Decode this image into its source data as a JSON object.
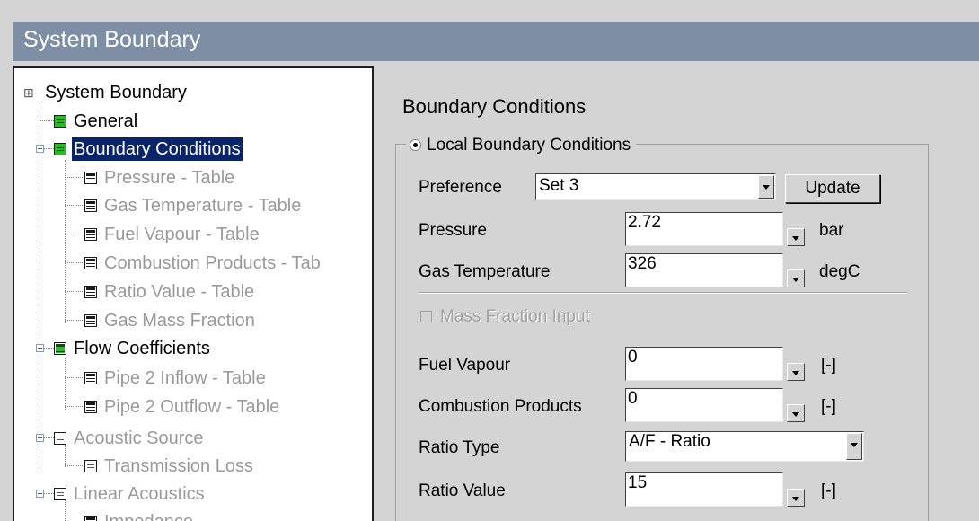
{
  "window": {
    "title": "System Boundary"
  },
  "tree": {
    "root_label": "System Boundary",
    "items": [
      {
        "label": "General",
        "icon": "green-table-icon",
        "state": "black"
      },
      {
        "label": "Boundary Conditions",
        "icon": "green-table-icon",
        "state": "selected"
      },
      {
        "label": "Pressure - Table",
        "icon": "table-icon",
        "state": "grey"
      },
      {
        "label": "Gas Temperature - Table",
        "icon": "table-icon",
        "state": "grey"
      },
      {
        "label": "Fuel Vapour - Table",
        "icon": "table-icon",
        "state": "grey"
      },
      {
        "label": "Combustion Products - Tab",
        "icon": "table-icon",
        "state": "grey"
      },
      {
        "label": "Ratio Value - Table",
        "icon": "table-icon",
        "state": "grey"
      },
      {
        "label": "Gas Mass Fraction",
        "icon": "table-icon",
        "state": "grey"
      },
      {
        "label": "Flow Coefficients",
        "icon": "green-table-icon",
        "state": "black"
      },
      {
        "label": "Pipe  2 Inflow - Table",
        "icon": "table-icon",
        "state": "grey"
      },
      {
        "label": "Pipe  2 Outflow - Table",
        "icon": "table-icon",
        "state": "grey"
      },
      {
        "label": "Acoustic Source",
        "icon": "grid-icon",
        "state": "grey"
      },
      {
        "label": "Transmission Loss",
        "icon": "grid-icon",
        "state": "grey"
      },
      {
        "label": "Linear Acoustics",
        "icon": "grid-icon",
        "state": "grey"
      },
      {
        "label": "Impedance",
        "icon": "table-icon",
        "state": "grey"
      }
    ]
  },
  "panel": {
    "heading": "Boundary Conditions",
    "group_label": "Local Boundary Conditions",
    "preference_label": "Preference",
    "preference_value": "Set 3",
    "update_button": "Update",
    "pressure": {
      "label": "Pressure",
      "value": "2.72",
      "unit": "bar"
    },
    "gas_temperature": {
      "label": "Gas Temperature",
      "value": "326",
      "unit": "degC"
    },
    "mass_fraction_input": {
      "label": "Mass Fraction Input",
      "checked": false,
      "enabled": false
    },
    "fuel_vapour": {
      "label": "Fuel Vapour",
      "value": "0",
      "unit": "[-]"
    },
    "combustion_products": {
      "label": "Combustion Products",
      "value": "0",
      "unit": "[-]"
    },
    "ratio_type": {
      "label": "Ratio Type",
      "value": "A/F - Ratio"
    },
    "ratio_value": {
      "label": "Ratio Value",
      "value": "15",
      "unit": "[-]"
    }
  },
  "colors": {
    "title_bar": "#7e8fa5",
    "selection": "#0a246a",
    "background": "#d4d4d4"
  }
}
